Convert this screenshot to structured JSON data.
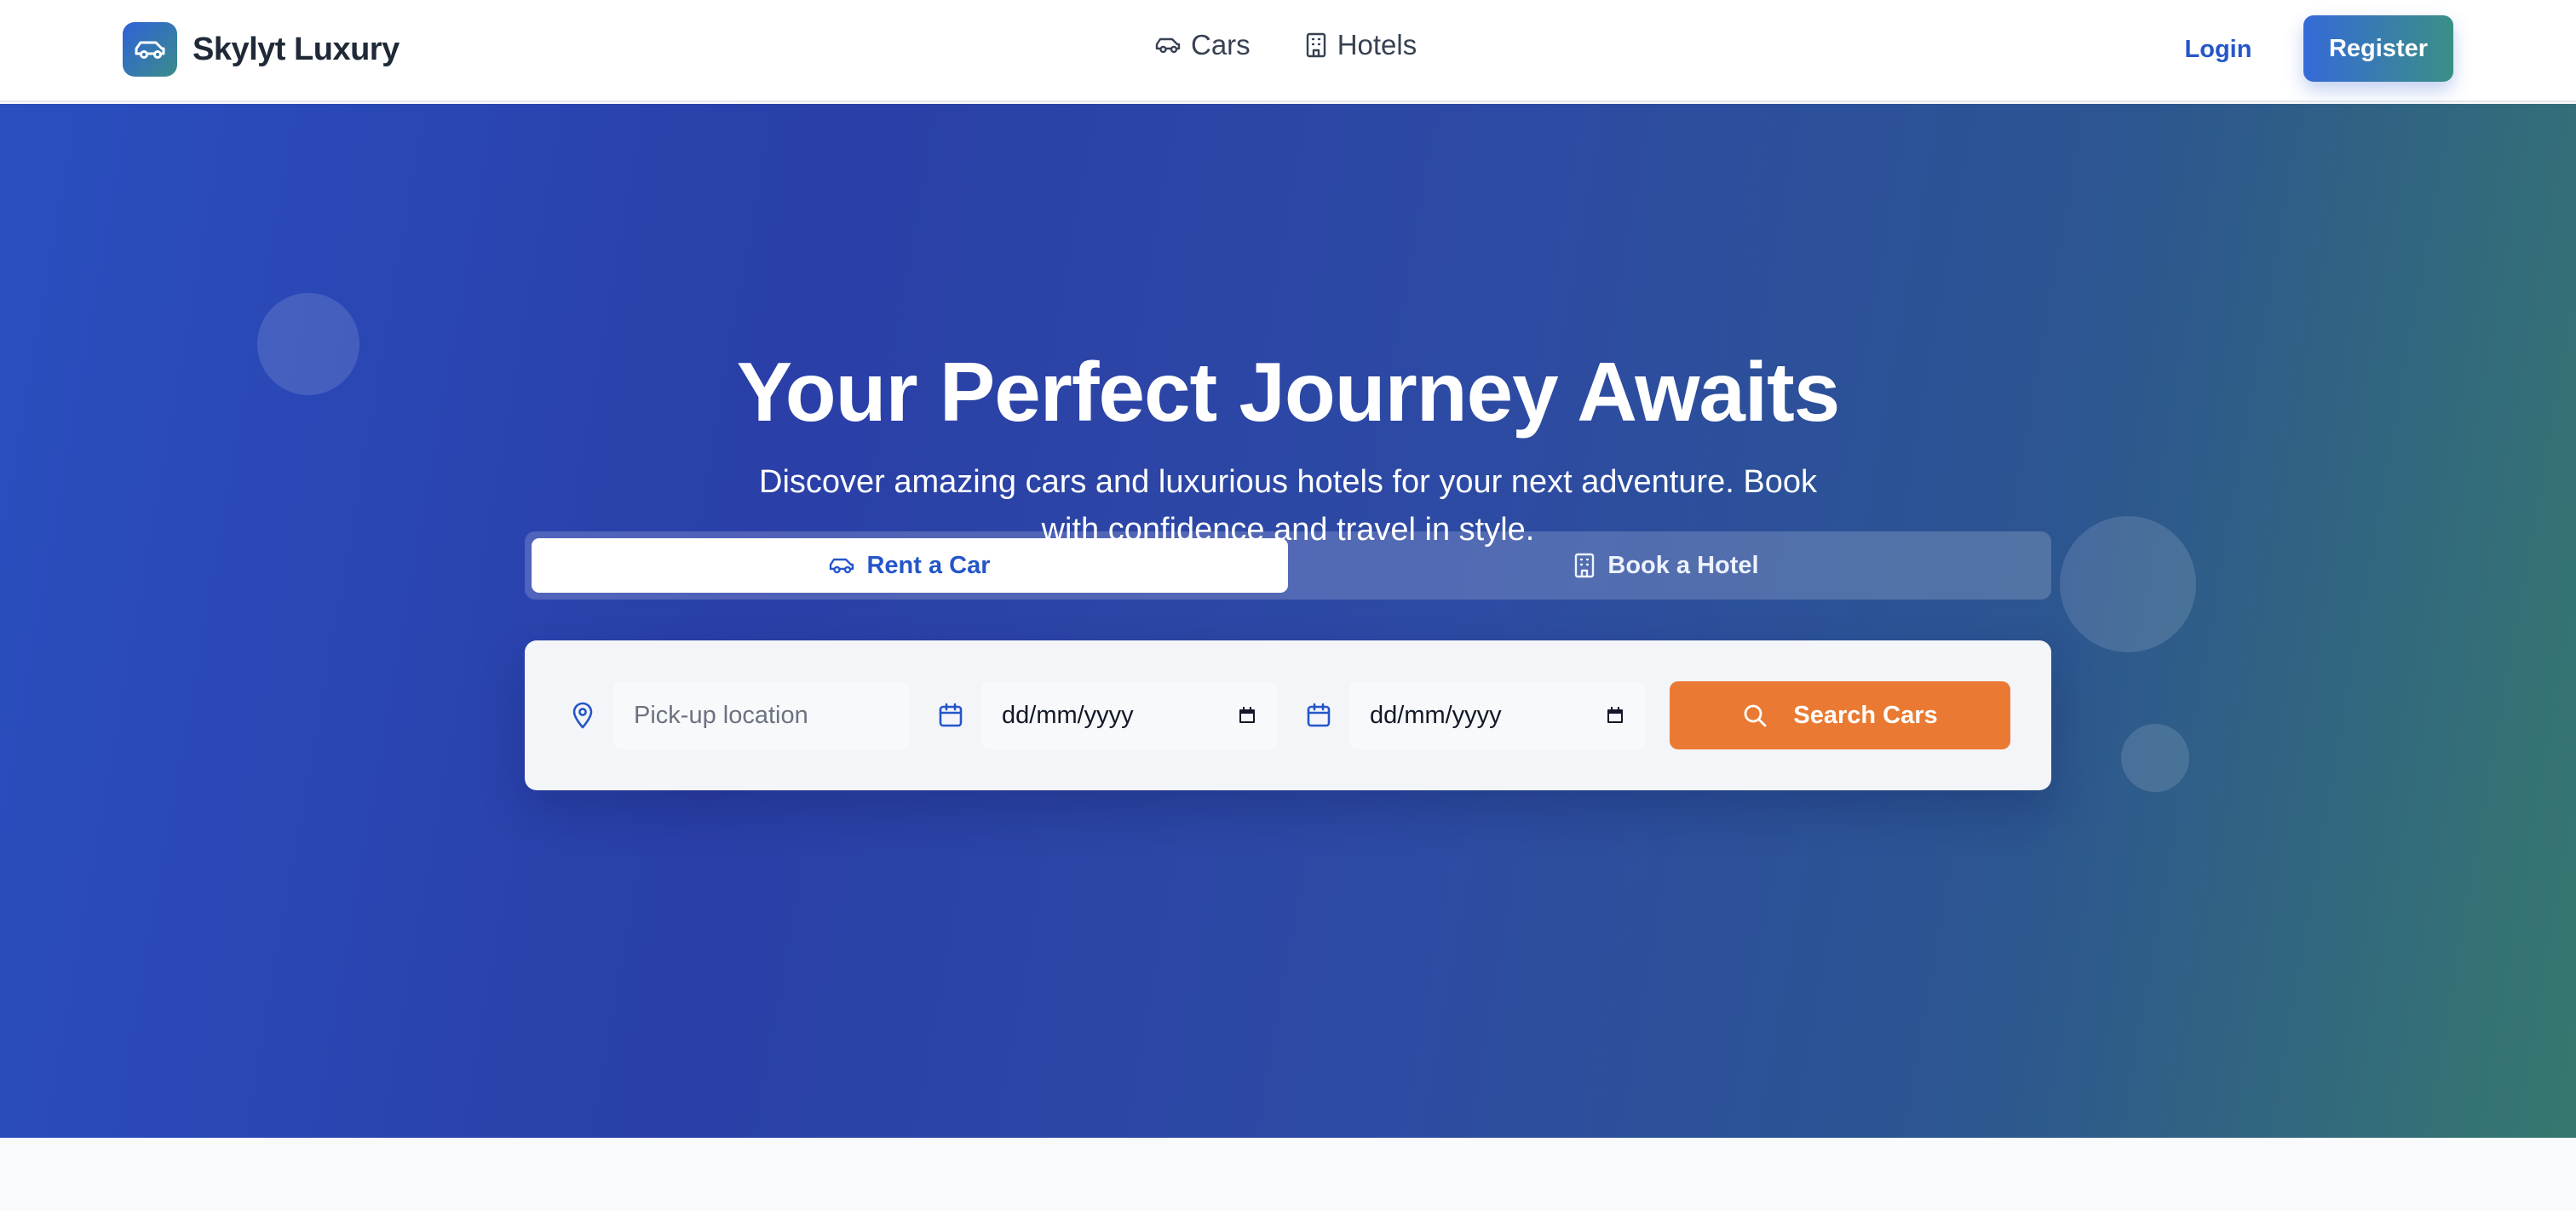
{
  "header": {
    "brand_name": "Skylyt Luxury",
    "nav": [
      {
        "label": "Cars",
        "icon": "car-icon"
      },
      {
        "label": "Hotels",
        "icon": "building-icon"
      }
    ],
    "login_label": "Login",
    "register_label": "Register"
  },
  "hero": {
    "title": "Your Perfect Journey Awaits",
    "subtitle": "Discover amazing cars and luxurious hotels for your next adventure. Book with confidence and travel in style."
  },
  "tabs": [
    {
      "label": "Rent a Car",
      "icon": "car-icon",
      "active": true
    },
    {
      "label": "Book a Hotel",
      "icon": "building-icon",
      "active": false
    }
  ],
  "search": {
    "location_placeholder": "Pick-up location",
    "pickup_date_value": "dd/mm/yyyy",
    "dropoff_date_value": "dd/mm/yyyy",
    "button_label": "Search Cars"
  },
  "colors": {
    "brand_blue": "#2556c8",
    "accent_orange": "#ea7a33",
    "hero_gradient_start": "#2a4fbf",
    "hero_gradient_end": "#37786e"
  }
}
